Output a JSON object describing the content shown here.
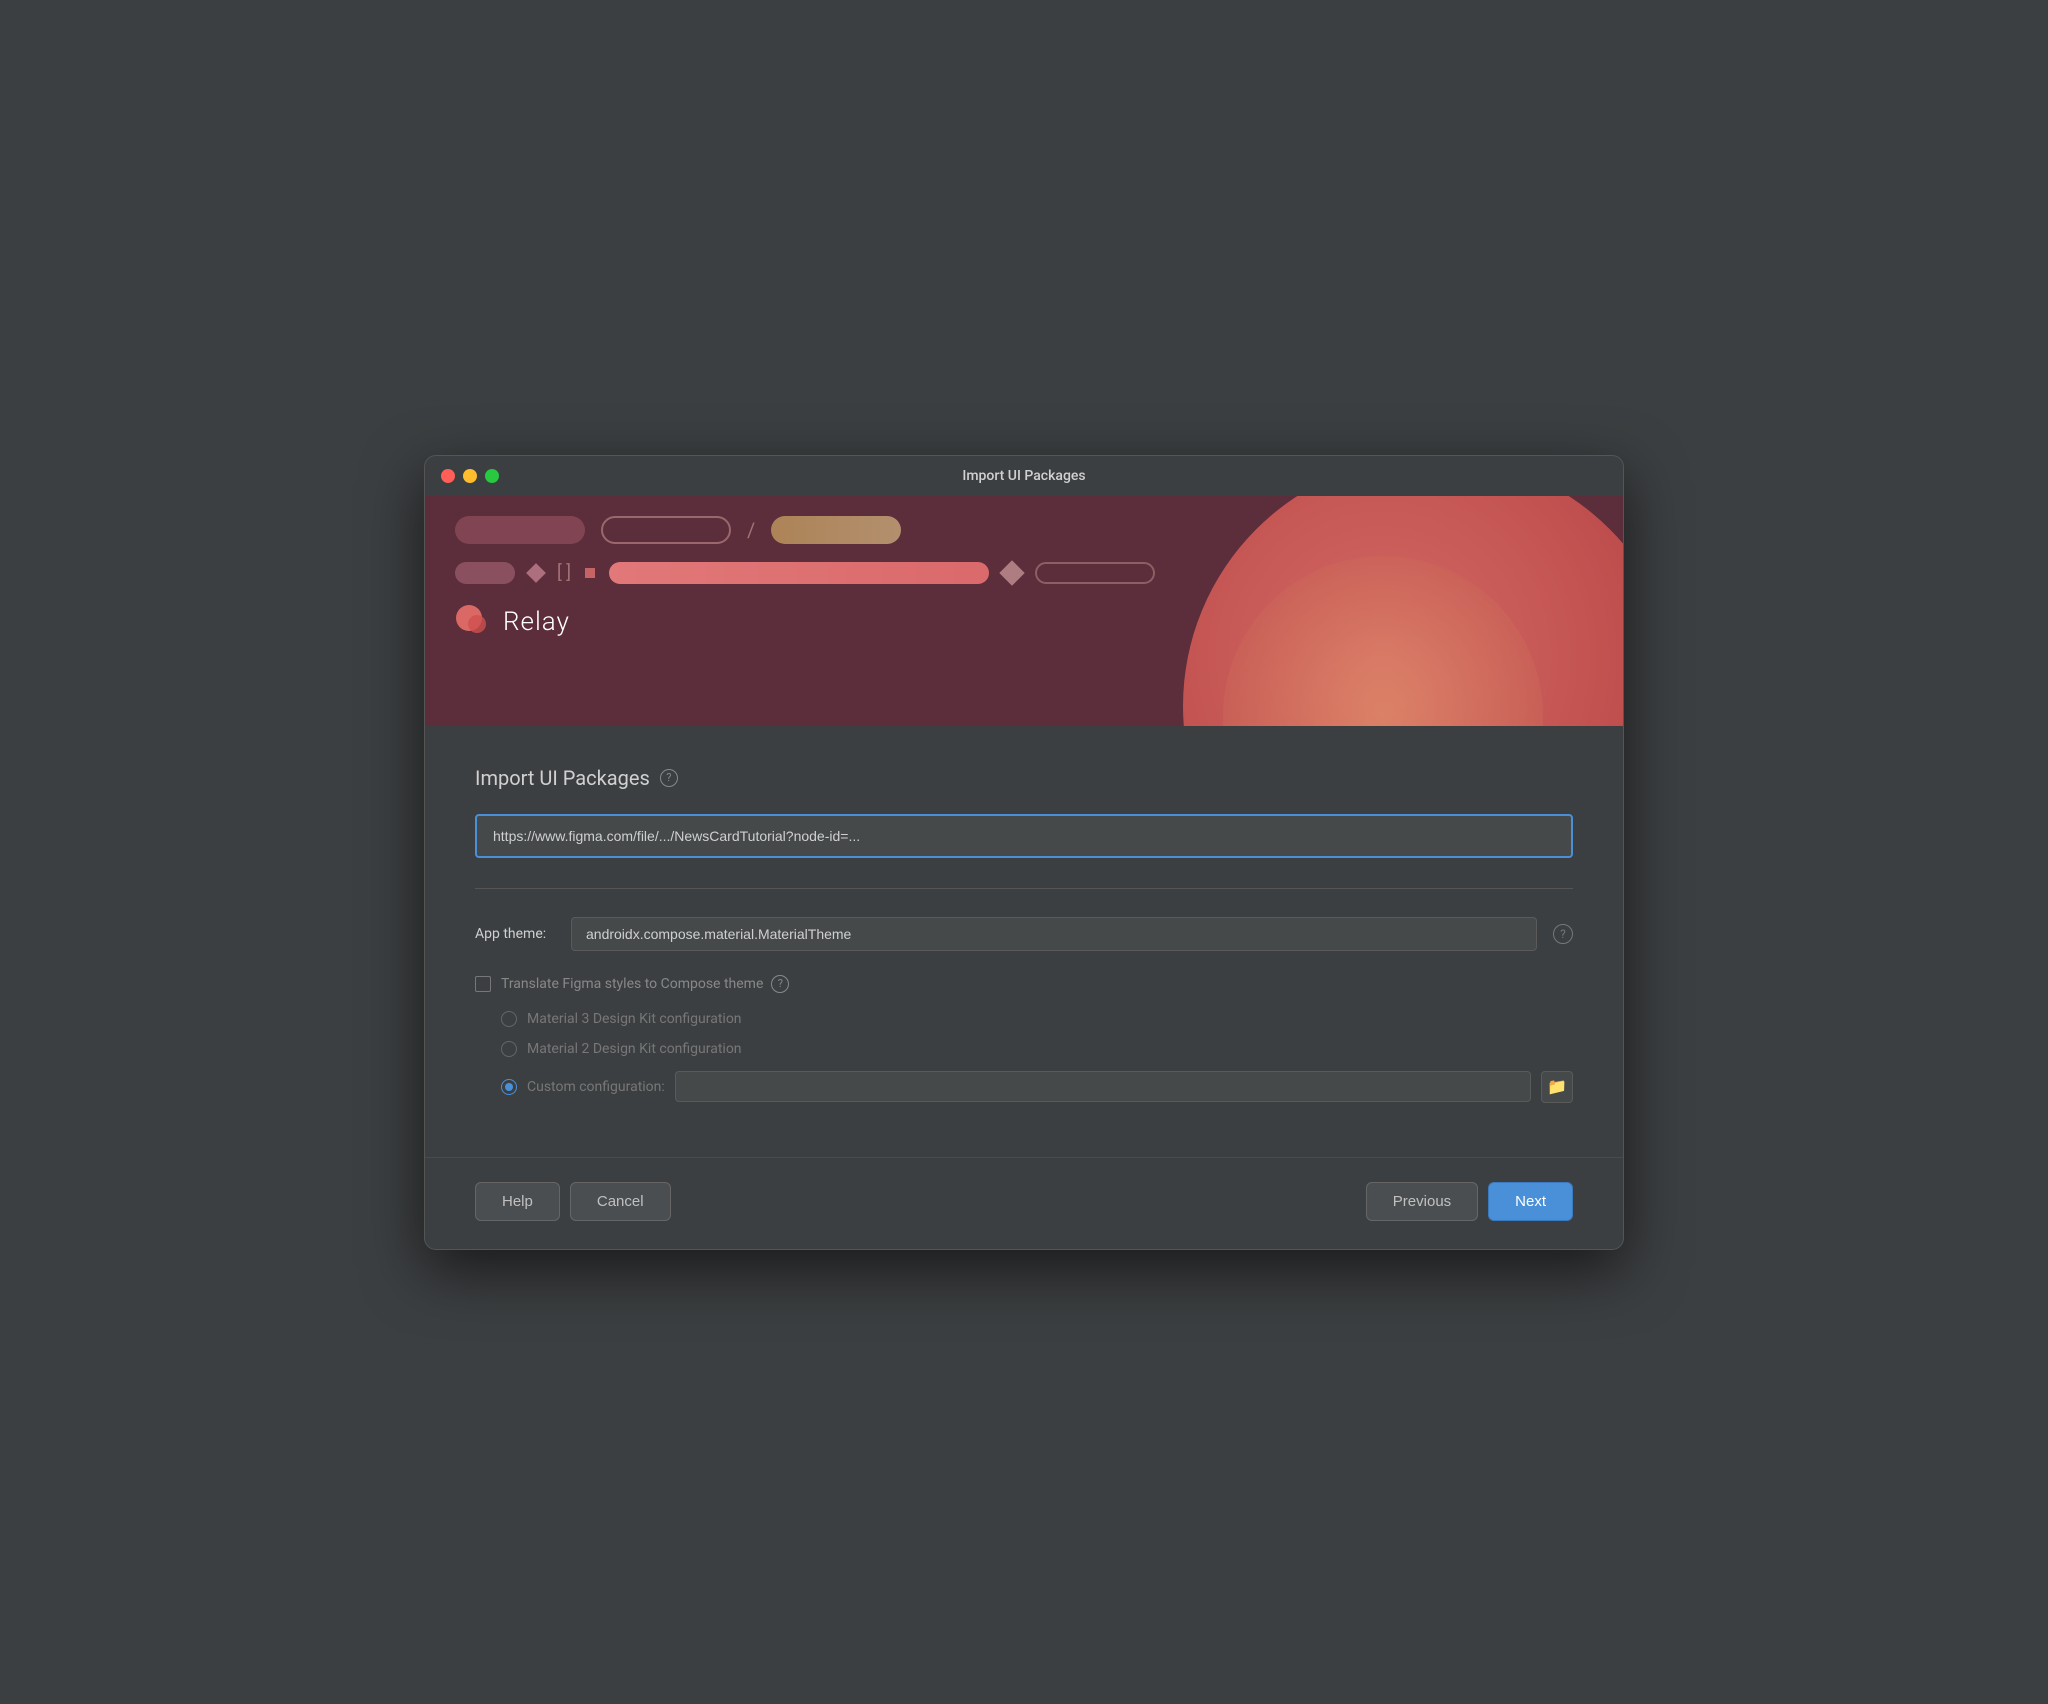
{
  "window": {
    "title": "Import UI Packages"
  },
  "header": {
    "logo_text": "Relay"
  },
  "form": {
    "section_title": "Import UI Packages",
    "url_placeholder": "https://www.figma.com/file/.../NewsCardTutorial?node-id=...",
    "url_value": "https://www.figma.com/file/.../NewsCardTutorial?node-id=...",
    "app_theme_label": "App theme:",
    "app_theme_value": "androidx.compose.material.MaterialTheme",
    "translate_checkbox_label": "Translate Figma styles to Compose theme",
    "radio_material3_label": "Material 3 Design Kit configuration",
    "radio_material2_label": "Material 2 Design Kit configuration",
    "radio_custom_label": "Custom configuration:",
    "custom_config_value": ""
  },
  "footer": {
    "help_label": "Help",
    "cancel_label": "Cancel",
    "previous_label": "Previous",
    "next_label": "Next"
  },
  "icons": {
    "question_mark": "?",
    "folder": "🗂"
  }
}
